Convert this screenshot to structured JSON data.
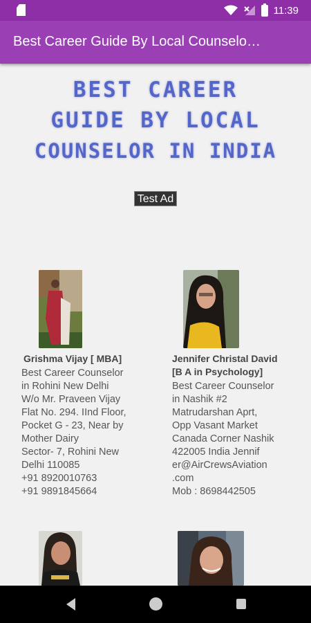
{
  "status_bar": {
    "time": "11:39"
  },
  "app_bar": {
    "title": "Best Career Guide By Local Counselo…"
  },
  "hero": {
    "lines": [
      "BEST CAREER",
      "GUIDE BY LOCAL",
      "COUNSELOR IN INDIA"
    ]
  },
  "ad": {
    "label": "Test Ad"
  },
  "counselors": [
    {
      "name": "Grishma Vijay [ MBA]",
      "description": " Best Career Counselor\nin Rohini New Delhi\nW/o Mr. Praveen Vijay\nFlat No. 294. IInd Floor,\nPocket G - 23, Near by\nMother Dairy\nSector- 7, Rohini New\nDelhi 110085\n+91 8920010763\n+91 9891845664"
    },
    {
      "name": "Jennifer Christal David\n[B A in Psychology]",
      "description": "Best Career Counselor\nin Nashik #2\nMatrudarshan Aprt,\nOpp Vasant Market\nCanada Corner Nashik\n422005  India Jennif\ner@AirCrewsAviation\n.com\n Mob : 8698442505"
    },
    {
      "name": "",
      "description": ""
    },
    {
      "name": "",
      "description": ""
    }
  ],
  "colors": {
    "status_bar": "#8e2fa8",
    "app_bar": "#9b3fb5",
    "hero_text": "#5566c9",
    "background": "#f2f1f1"
  }
}
